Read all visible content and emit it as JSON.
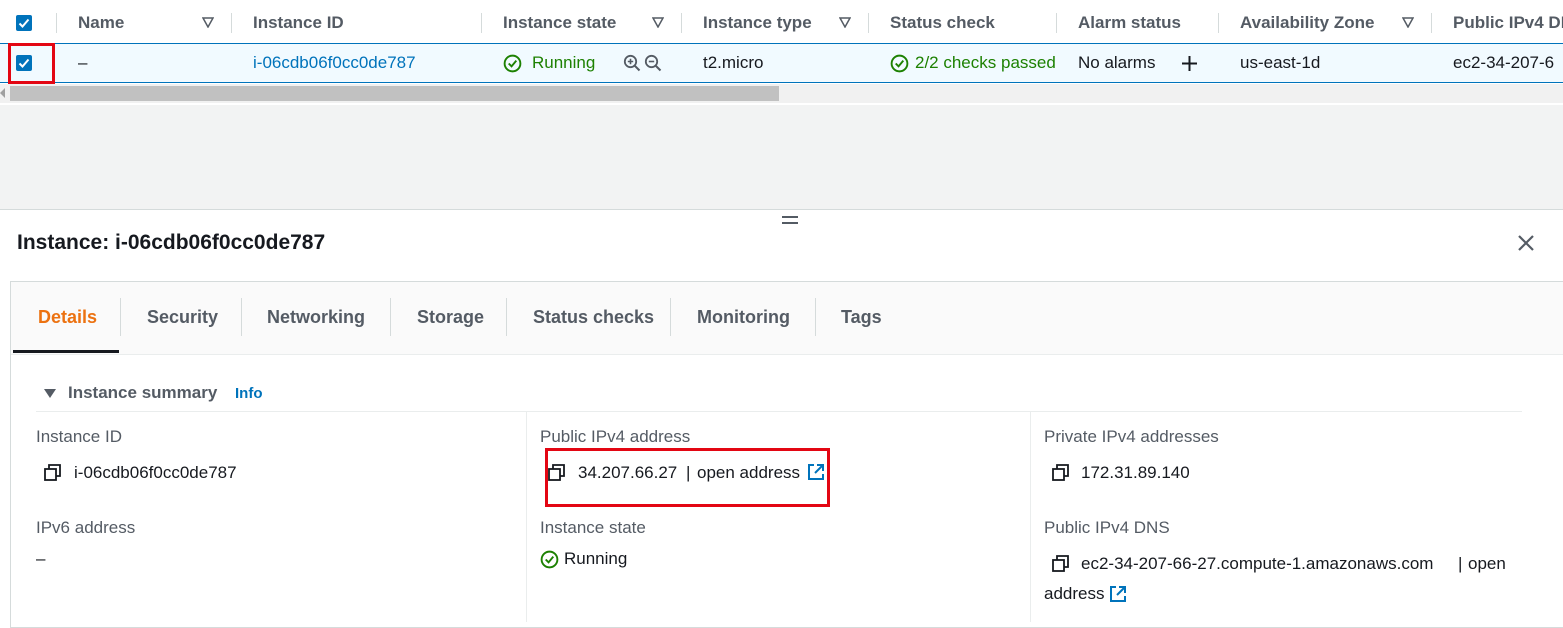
{
  "table": {
    "columns": [
      "Name",
      "Instance ID",
      "Instance state",
      "Instance type",
      "Status check",
      "Alarm status",
      "Availability Zone",
      "Public IPv4 DNS"
    ],
    "row": {
      "name": "–",
      "instance_id": "i-06cdb06f0cc0de787",
      "instance_state": "Running",
      "instance_type": "t2.micro",
      "status_check": "2/2 checks passed",
      "alarm_status": "No alarms",
      "availability_zone": "us-east-1d",
      "public_dns": "ec2-34-207-6"
    }
  },
  "details": {
    "title": "Instance: i-06cdb06f0cc0de787",
    "tabs": [
      "Details",
      "Security",
      "Networking",
      "Storage",
      "Status checks",
      "Monitoring",
      "Tags"
    ],
    "active_tab": "Details",
    "summary": {
      "title": "Instance summary",
      "info_link": "Info",
      "instance_id_label": "Instance ID",
      "instance_id_value": "i-06cdb06f0cc0de787",
      "ipv6_label": "IPv6 address",
      "ipv6_value": "–",
      "public_ipv4_label": "Public IPv4 address",
      "public_ipv4_value": "34.207.66.27",
      "separator": "|",
      "open_address": "open address",
      "instance_state_label": "Instance state",
      "instance_state_value": "Running",
      "private_ipv4_label": "Private IPv4 addresses",
      "private_ipv4_value": "172.31.89.140",
      "public_dns_label": "Public IPv4 DNS",
      "public_dns_value": "ec2-34-207-66-27.compute-1.amazonaws.com",
      "open_address_part1": "open",
      "open_address_part2": "address"
    }
  },
  "colors": {
    "link": "#0073bb",
    "success": "#1d8102",
    "active_tab": "#ec7211",
    "highlight": "#e30613",
    "selected_row_bg": "#f1faff"
  },
  "icons": [
    "checkbox-checked-icon",
    "sort-triangle-icon",
    "status-ok-icon",
    "zoom-in-icon",
    "zoom-out-icon",
    "plus-icon",
    "drag-handle-icon",
    "close-icon",
    "caret-down-icon",
    "copy-icon",
    "external-link-icon"
  ]
}
